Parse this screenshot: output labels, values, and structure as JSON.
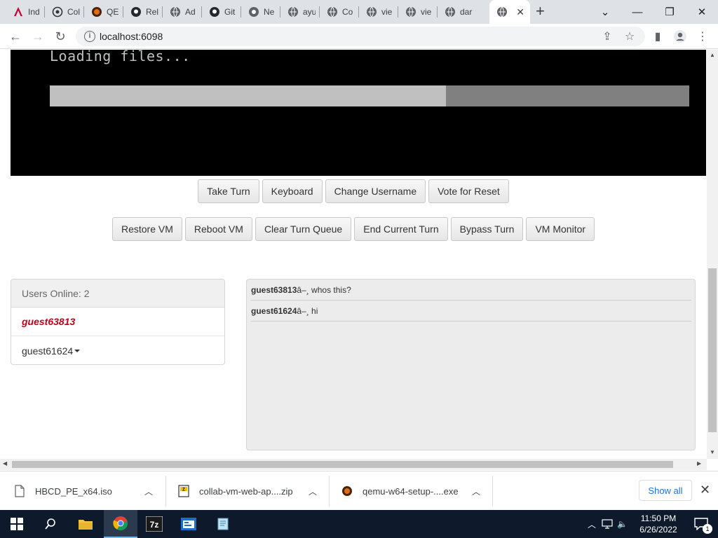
{
  "browser": {
    "tabs": [
      {
        "label": "Ind",
        "icon": "angular-icon"
      },
      {
        "label": "Col",
        "icon": "collab-icon"
      },
      {
        "label": "QE",
        "icon": "qemu-icon"
      },
      {
        "label": "Rel",
        "icon": "github-icon"
      },
      {
        "label": "Ad",
        "icon": "globe-icon"
      },
      {
        "label": "Git",
        "icon": "github-icon"
      },
      {
        "label": "Ne",
        "icon": "chrome-icon"
      },
      {
        "label": "ayu",
        "icon": "globe-icon"
      },
      {
        "label": "Co",
        "icon": "globe-icon"
      },
      {
        "label": "vie",
        "icon": "globe-icon"
      },
      {
        "label": "vie",
        "icon": "globe-icon"
      },
      {
        "label": "dar",
        "icon": "globe-icon"
      },
      {
        "label": "",
        "icon": "globe-icon",
        "active": true
      }
    ],
    "url": "localhost:6098"
  },
  "vm": {
    "screen_text": "Loading files...",
    "progress": 0.62
  },
  "buttons_row1": [
    "Take Turn",
    "Keyboard",
    "Change Username",
    "Vote for Reset"
  ],
  "buttons_row2": [
    "Restore VM",
    "Reboot VM",
    "Clear Turn Queue",
    "End Current Turn",
    "Bypass Turn",
    "VM Monitor"
  ],
  "users": {
    "header": "Users Online: 2",
    "list": [
      "guest63813",
      "guest61624"
    ]
  },
  "chat": [
    {
      "name": "guest63813",
      "sep": "â–¸",
      "text": " whos this?"
    },
    {
      "name": "guest61624",
      "sep": "â–¸",
      "text": " hi"
    }
  ],
  "downloads": [
    {
      "name": "HBCD_PE_x64.iso",
      "icon": "file-icon"
    },
    {
      "name": "collab-vm-web-ap....zip",
      "icon": "zip-icon"
    },
    {
      "name": "qemu-w64-setup-....exe",
      "icon": "qemu-icon"
    }
  ],
  "shelf": {
    "show_all": "Show all"
  },
  "taskbar": {
    "time": "11:50 PM",
    "date": "6/26/2022",
    "notifications": "1"
  },
  "colors": {
    "accent": "#1a73e8",
    "self_user": "#c0001a",
    "taskbar": "#0e1a2b"
  }
}
